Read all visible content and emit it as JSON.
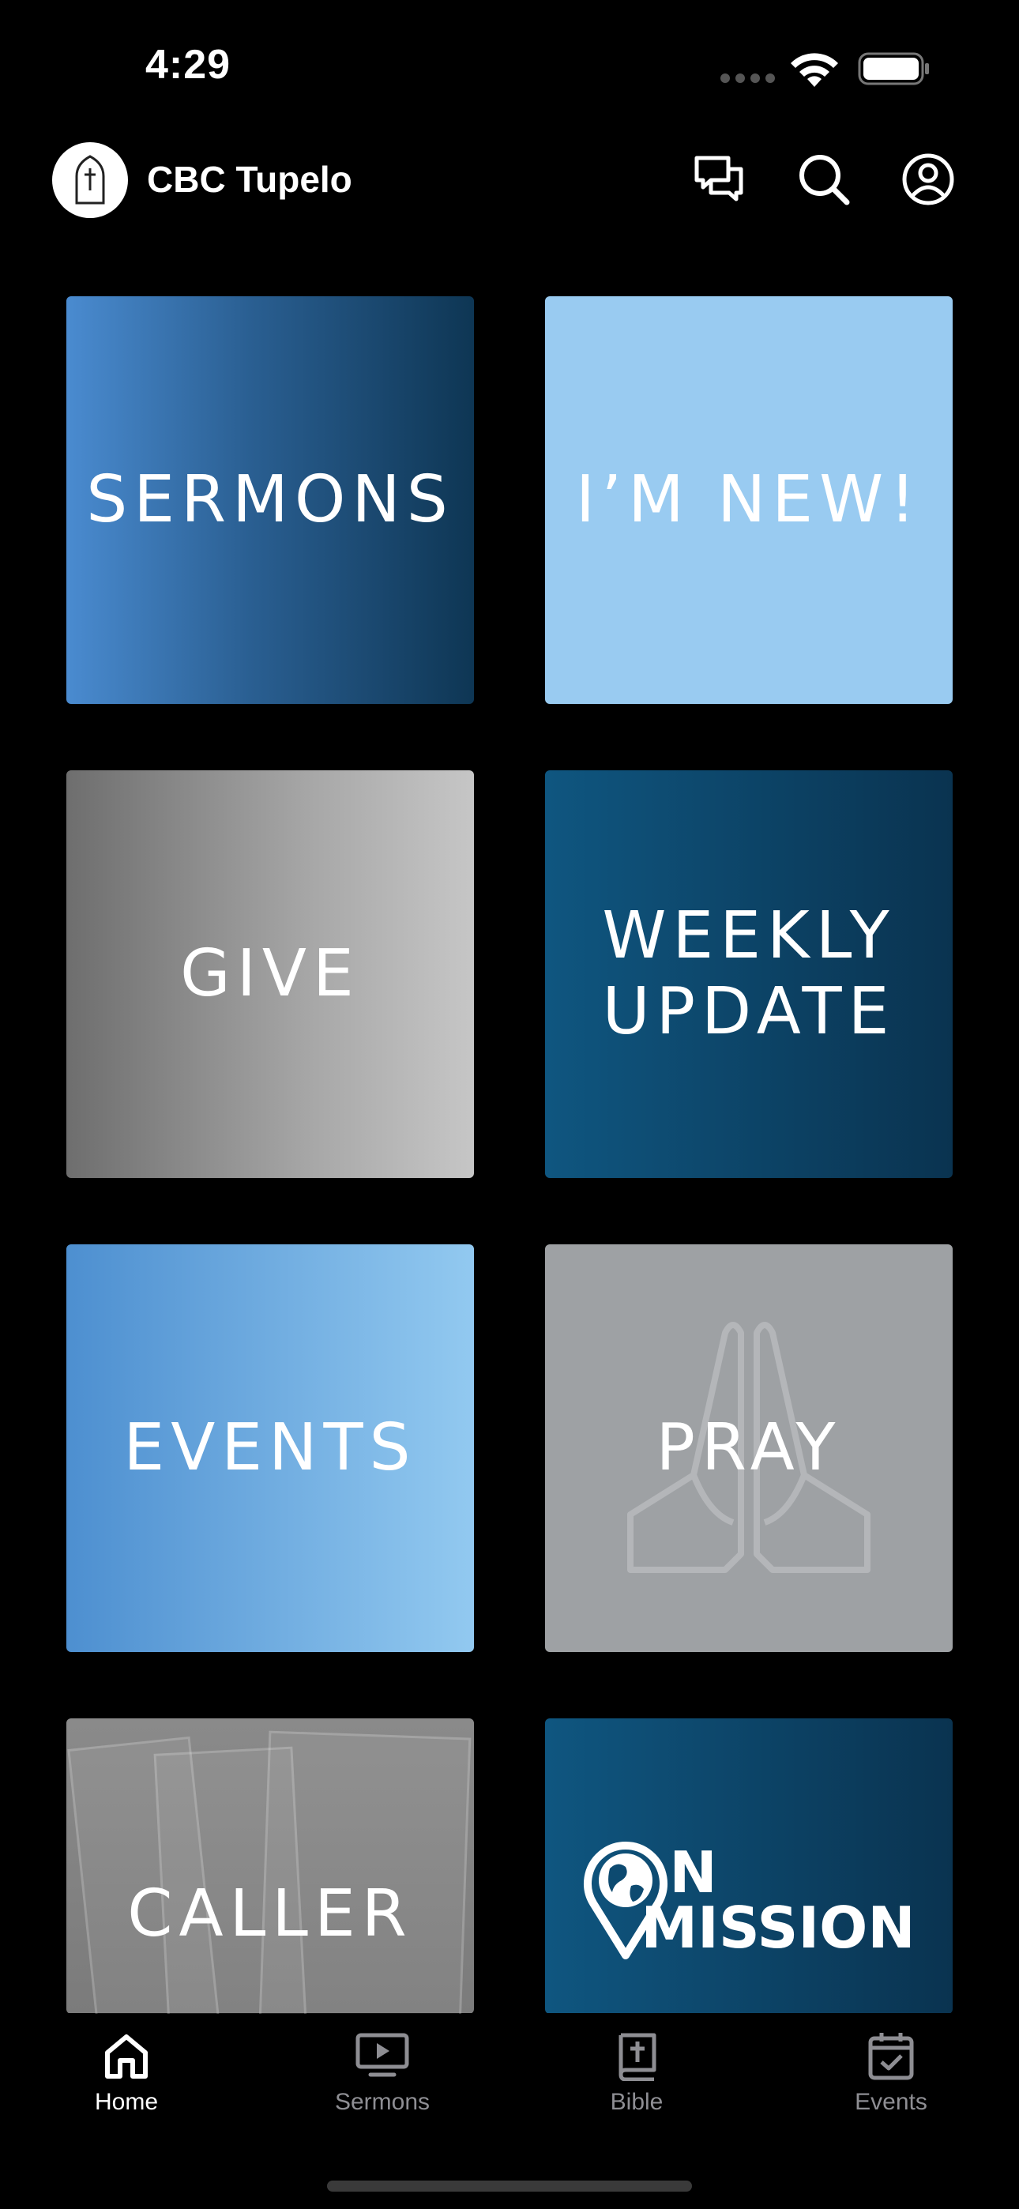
{
  "status_bar": {
    "time": "4:29"
  },
  "header": {
    "title": "CBC Tupelo"
  },
  "tiles": [
    {
      "label": "SERMONS"
    },
    {
      "label": "I’M NEW!"
    },
    {
      "label": "GIVE"
    },
    {
      "label_line1": "WEEKLY",
      "label_line2": "UPDATE"
    },
    {
      "label": "EVENTS"
    },
    {
      "label": "PRAY"
    },
    {
      "label": "CALLER"
    },
    {
      "label_line1": "N",
      "label_line2": "MISSION"
    }
  ],
  "tab_bar": {
    "items": [
      {
        "label": "Home",
        "icon": "home-icon",
        "active": true
      },
      {
        "label": "Sermons",
        "icon": "video-icon",
        "active": false
      },
      {
        "label": "Bible",
        "icon": "bible-icon",
        "active": false
      },
      {
        "label": "Events",
        "icon": "calendar-icon",
        "active": false
      }
    ]
  },
  "colors": {
    "background": "#000000",
    "tab_active": "#ffffff",
    "tab_inactive": "#8e8e93",
    "new_tile": "#99cbf1",
    "pray_tile": "#9ea1a4"
  }
}
